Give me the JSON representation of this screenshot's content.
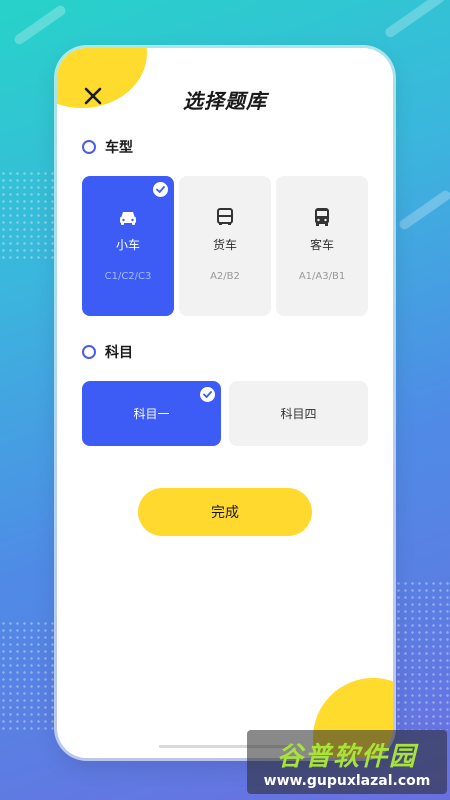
{
  "header": {
    "close_icon": "close-icon",
    "title": "选择题库"
  },
  "vehicle_section": {
    "label": "车型",
    "options": [
      {
        "name": "小车",
        "codes": "C1/C2/C3",
        "icon": "car-icon",
        "selected": true
      },
      {
        "name": "货车",
        "codes": "A2/B2",
        "icon": "truck-icon",
        "selected": false
      },
      {
        "name": "客车",
        "codes": "A1/A3/B1",
        "icon": "bus-icon",
        "selected": false
      }
    ]
  },
  "subject_section": {
    "label": "科目",
    "options": [
      {
        "name": "科目一",
        "selected": true
      },
      {
        "name": "科目四",
        "selected": false
      }
    ]
  },
  "done_button": {
    "label": "完成"
  },
  "watermark": {
    "title": "谷普软件园",
    "url": "www.gupuxlazal.com"
  },
  "colors": {
    "accent": "#3c5cf5",
    "yellow": "#ffd92e",
    "card_bg": "#f2f2f2"
  }
}
